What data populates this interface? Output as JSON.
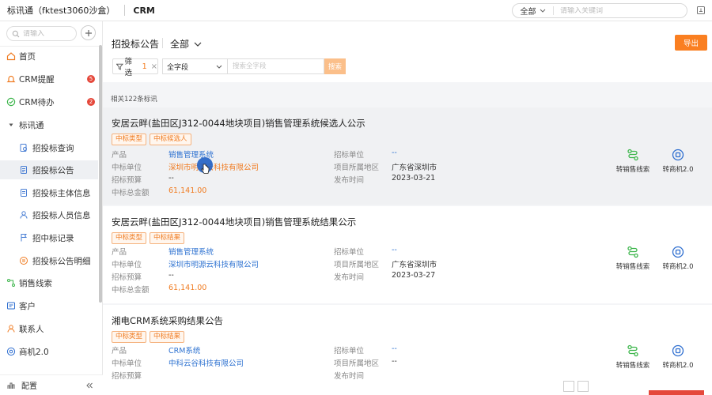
{
  "topbar": {
    "app_title": "标讯通（fktest3060沙盒）",
    "module_title": "CRM",
    "search_scope": "全部",
    "search_placeholder": "请输入关键词"
  },
  "sidebar": {
    "search_placeholder": "请输入",
    "items": [
      {
        "label": "首页",
        "icon": "home-icon"
      },
      {
        "label": "CRM提醒",
        "icon": "bell-icon",
        "badge": "5"
      },
      {
        "label": "CRM待办",
        "icon": "check-circle-icon",
        "badge": "2"
      },
      {
        "label": "标讯通",
        "icon": "caret-down-icon"
      },
      {
        "label": "招投标查询",
        "icon": "document-search-icon"
      },
      {
        "label": "招投标公告",
        "icon": "document-icon"
      },
      {
        "label": "招投标主体信息",
        "icon": "document-icon"
      },
      {
        "label": "招投标人员信息",
        "icon": "person-icon"
      },
      {
        "label": "招中标记录",
        "icon": "flag-icon"
      },
      {
        "label": "招投标公告明细",
        "icon": "document-search-icon"
      },
      {
        "label": "销售线索",
        "icon": "lead-icon"
      },
      {
        "label": "客户",
        "icon": "customer-icon"
      },
      {
        "label": "联系人",
        "icon": "contact-icon"
      },
      {
        "label": "商机2.0",
        "icon": "opportunity-icon"
      }
    ],
    "settings_label": "配置",
    "accent": "#f07c22"
  },
  "main": {
    "breadcrumb": "招投标公告",
    "scope": "全部",
    "export_label": "导出",
    "filter": {
      "label": "筛选",
      "count": "1"
    },
    "field_select": "全字段",
    "search_placeholder": "搜索全字段",
    "search_label": "搜索",
    "result_count": "相关122条标讯",
    "field_labels": {
      "product": "产品",
      "winner": "中标单位",
      "budget": "招标预算",
      "total": "中标总金额",
      "bidder": "招标单位",
      "region": "项目所属地区",
      "publish": "发布时间"
    },
    "actions": {
      "to_lead": "转销售线索",
      "to_opportunity": "转商机2.0"
    },
    "cards": [
      {
        "title": "安居云畔(盐田区J312-0044地块项目)销售管理系统候选人公示",
        "tags": [
          "中标类型",
          "中标候选人"
        ],
        "product": "销售管理系统",
        "winner": "深圳市明源云科技有限公司",
        "budget": "--",
        "total": "61,141.00",
        "bidder": "--",
        "region": "广东省深圳市",
        "publish": "2023-03-21"
      },
      {
        "title": "安居云畔(盐田区J312-0044地块项目)销售管理系统结果公示",
        "tags": [
          "中标类型",
          "中标结果"
        ],
        "product": "销售管理系统",
        "winner": "深圳市明源云科技有限公司",
        "budget": "--",
        "total": "61,141.00",
        "bidder": "--",
        "region": "广东省深圳市",
        "publish": "2023-03-27"
      },
      {
        "title": "湘电CRM系统采购结果公告",
        "tags": [
          "中标类型",
          "中标结果"
        ],
        "product": "CRM系统",
        "winner": "中科云谷科技有限公司",
        "budget": "",
        "total": "",
        "bidder": "--",
        "region": "--",
        "publish": ""
      }
    ]
  },
  "colors": {
    "orange": "#f07c22",
    "link": "#2f73d1",
    "green": "#3bb54a",
    "blue": "#2f6fd0",
    "badge": "#e5483b"
  }
}
